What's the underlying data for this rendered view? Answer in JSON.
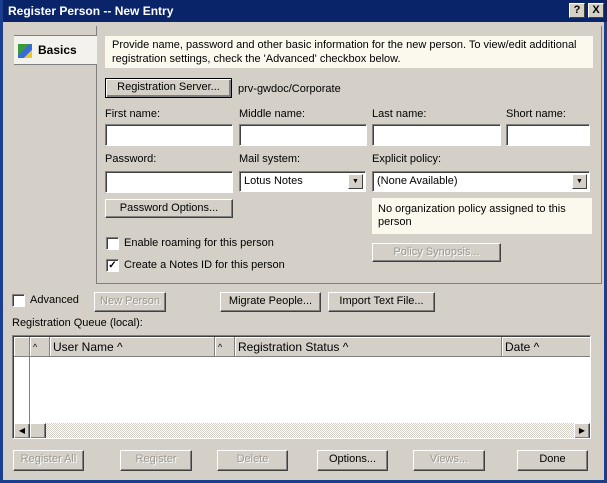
{
  "window": {
    "title": "Register Person -- New Entry",
    "help": "?",
    "close": "X"
  },
  "tabs": [
    {
      "label": "Basics",
      "icon": "basics-icon"
    }
  ],
  "info": "Provide name, password and other basic information for the new person.  To view/edit additional registration settings, check the 'Advanced' checkbox below.",
  "registration_server": {
    "button": "Registration Server...",
    "value": "prv-gwdoc/Corporate"
  },
  "fields": {
    "first_name": {
      "label": "First name:",
      "value": ""
    },
    "middle_name": {
      "label": "Middle name:",
      "value": ""
    },
    "last_name": {
      "label": "Last name:",
      "value": ""
    },
    "short_name": {
      "label": "Short name:",
      "value": ""
    },
    "password": {
      "label": "Password:",
      "value": ""
    },
    "mail_system": {
      "label": "Mail system:",
      "value": "Lotus Notes"
    },
    "explicit_policy": {
      "label": "Explicit policy:",
      "value": "(None Available)"
    }
  },
  "password_options": "Password Options...",
  "policy_note": "No organization policy assigned to this person",
  "policy_synopsis": "Policy Synopsis...",
  "checks": {
    "roaming": {
      "label": "Enable roaming for this person",
      "checked": false
    },
    "notes_id": {
      "label": "Create a Notes ID for this person",
      "checked": true
    },
    "advanced": {
      "label": "Advanced",
      "checked": false
    }
  },
  "actions": {
    "new_person": "New Person",
    "migrate": "Migrate People...",
    "import": "Import Text File..."
  },
  "queue": {
    "label": "Registration Queue (local):",
    "columns": [
      "User Name ^",
      "Registration Status ^",
      "Date ^"
    ],
    "sort_arrow": "^",
    "rows": []
  },
  "bottom": {
    "register_all": "Register All",
    "register": "Register",
    "delete": "Delete",
    "options": "Options...",
    "views": "Views...",
    "done": "Done"
  },
  "colors": {
    "titlebar": "#0A246A",
    "face": "#D4D0C8",
    "info_bg": "#FBF8EE"
  }
}
